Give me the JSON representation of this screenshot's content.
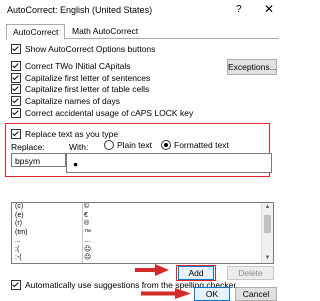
{
  "window": {
    "title": "AutoCorrect: English (United States)",
    "help_glyph": "?",
    "close_glyph": "✕"
  },
  "tabs": [
    {
      "label": "AutoCorrect",
      "active": true
    },
    {
      "label": "Math AutoCorrect",
      "active": false
    }
  ],
  "options": {
    "show_buttons": "Show AutoCorrect Options buttons",
    "correct_two_initial": "Correct TWo INitial CApitals",
    "capitalize_sentences": "Capitalize first letter of sentences",
    "capitalize_table_cells": "Capitalize first letter of table cells",
    "capitalize_days": "Capitalize names of days",
    "correct_caps_lock": "Correct accidental usage of cAPS LOCK key",
    "exceptions_label": "Exceptions..."
  },
  "replace": {
    "checkbox_label": "Replace text as you type",
    "replace_label": "Replace:",
    "with_label": "With:",
    "plain_text_label": "Plain text",
    "formatted_text_label": "Formatted text",
    "replace_value": "bpsym",
    "with_value": "●",
    "selected_format": "Formatted text"
  },
  "entries": [
    {
      "key": "(c)",
      "value": "©"
    },
    {
      "key": "(e)",
      "value": "€"
    },
    {
      "key": "(r)",
      "value": "®"
    },
    {
      "key": "(tm)",
      "value": "™"
    },
    {
      "key": "...",
      "value": "…"
    },
    {
      "key": ":(",
      "value": "☹"
    },
    {
      "key": ":-(",
      "value": "☹"
    }
  ],
  "buttons": {
    "add": "Add",
    "delete": "Delete",
    "ok": "OK",
    "cancel": "Cancel"
  },
  "footer": {
    "auto_suggest": "Automatically use suggestions from the spelling checker"
  },
  "colors": {
    "highlight_red": "#e0262b",
    "arrow_red": "#d42a2a",
    "primary_button_border": "#0078d7"
  }
}
